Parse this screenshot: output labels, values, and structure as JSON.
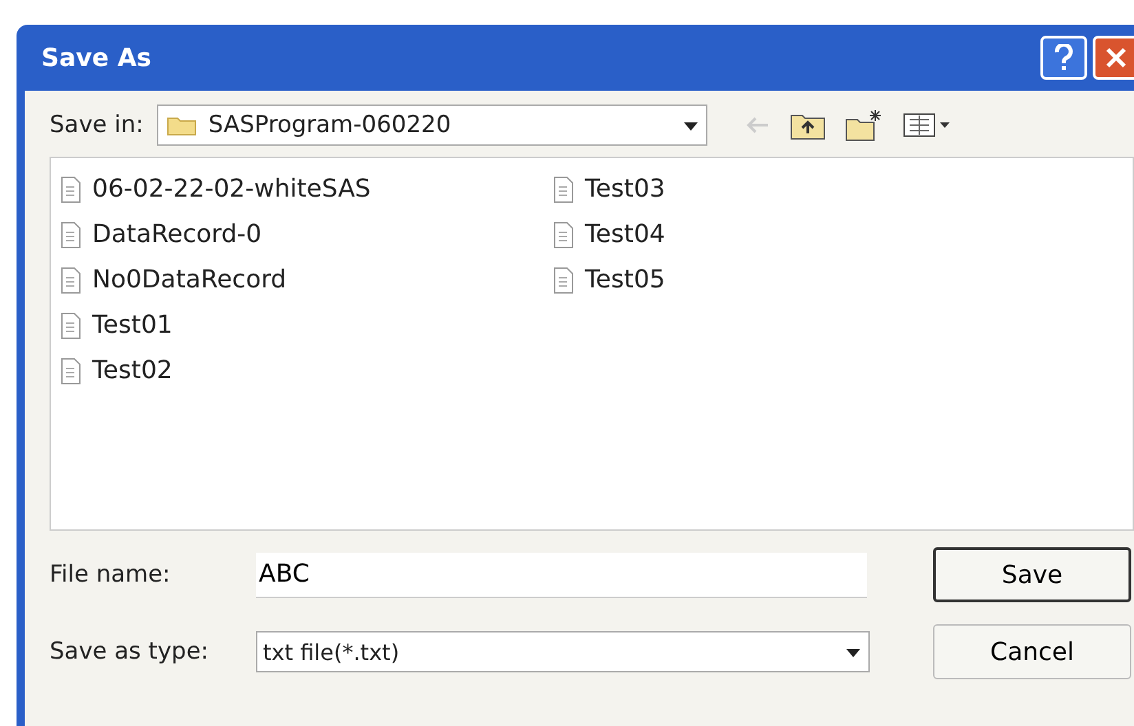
{
  "window": {
    "title": "Save As"
  },
  "save_in": {
    "label": "Save in:",
    "value": "SASProgram-060220"
  },
  "files": [
    {
      "name": "06-02-22-02-whiteSAS"
    },
    {
      "name": "DataRecord-0"
    },
    {
      "name": "No0DataRecord"
    },
    {
      "name": "Test01"
    },
    {
      "name": "Test02"
    },
    {
      "name": "Test03"
    },
    {
      "name": "Test04"
    },
    {
      "name": "Test05"
    }
  ],
  "file_name": {
    "label": "File name:",
    "value": "ABC"
  },
  "save_as_type": {
    "label": "Save as type:",
    "value": "txt file(*.txt)"
  },
  "buttons": [
    {
      "label": "Save",
      "default": true
    },
    {
      "label": "Cancel",
      "default": false
    }
  ]
}
